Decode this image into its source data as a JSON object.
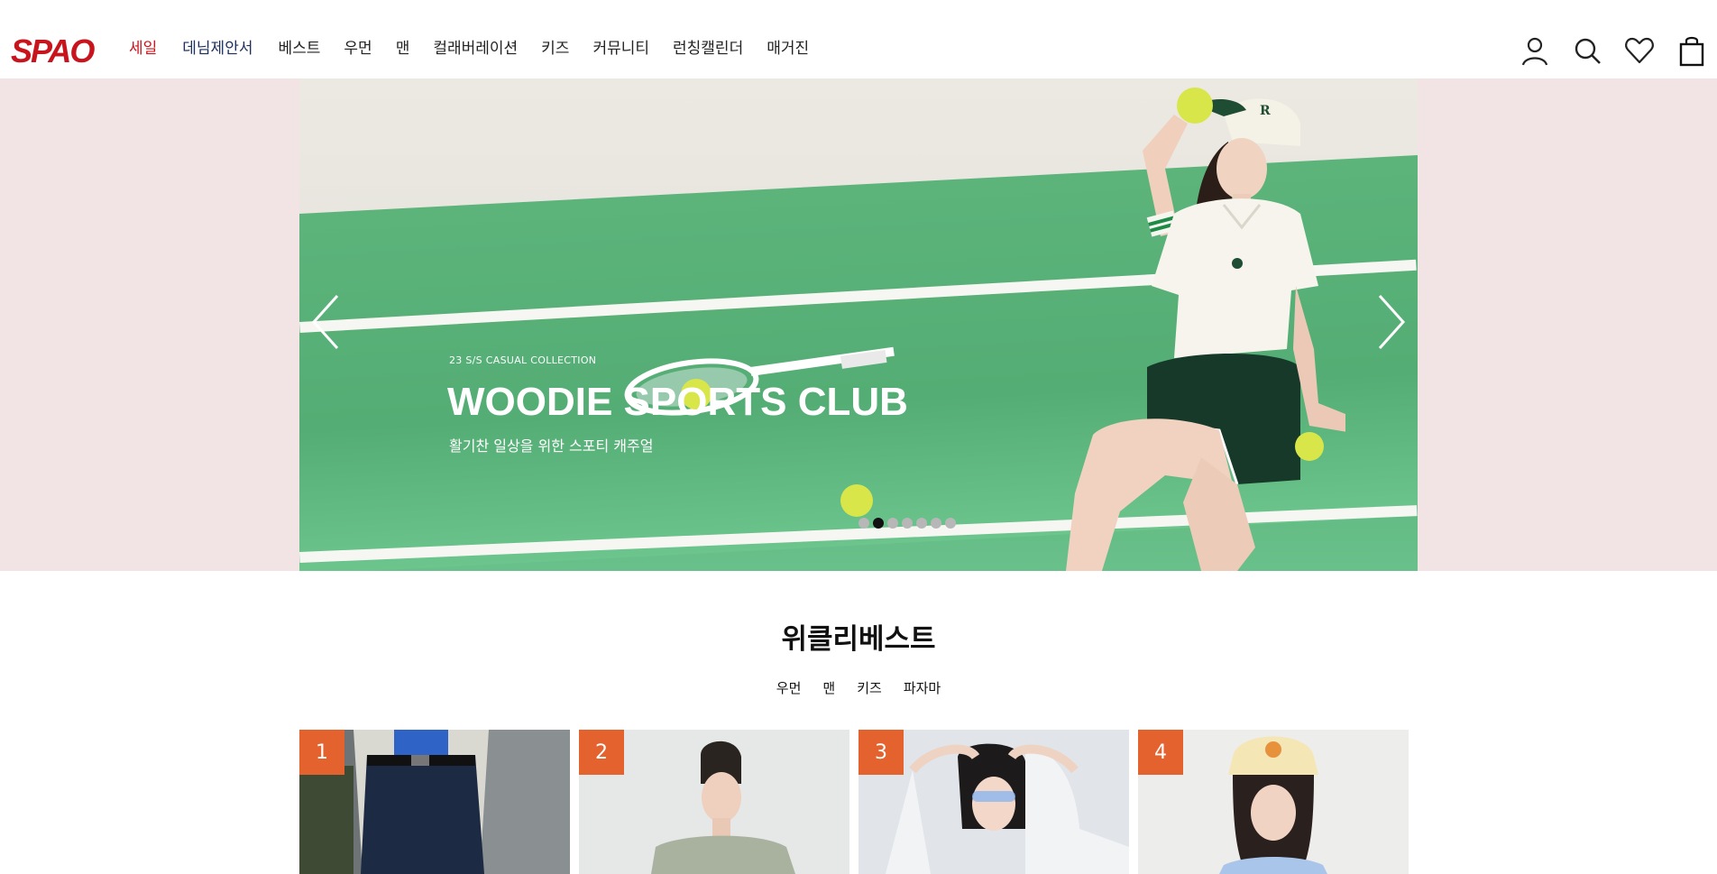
{
  "brand": {
    "logo_text": "SPAO",
    "color": "#c8151d"
  },
  "nav": {
    "items": [
      "세일",
      "데님제안서",
      "베스트",
      "우먼",
      "맨",
      "컬래버레이션",
      "키즈",
      "커뮤니티",
      "런칭캘린더",
      "매거진"
    ]
  },
  "header_icons": [
    "user-icon",
    "search-icon",
    "heart-icon",
    "shopping-bag-icon"
  ],
  "hero": {
    "subtitle": "23 S/S CASUAL COLLECTION",
    "title": "WOODIE  SPORTS CLUB",
    "description": "활기찬 일상을 위한 스포티 캐주얼",
    "slide_count": 7,
    "active_slide": 2,
    "background": "#f2e3e4",
    "court_color": "#5cb47b"
  },
  "weekly_best": {
    "title": "위클리베스트",
    "tabs": [
      "우먼",
      "맨",
      "키즈",
      "파자마"
    ],
    "products": [
      {
        "rank": "1"
      },
      {
        "rank": "2"
      },
      {
        "rank": "3"
      },
      {
        "rank": "4"
      }
    ],
    "rank_badge_color": "#e4622e"
  }
}
